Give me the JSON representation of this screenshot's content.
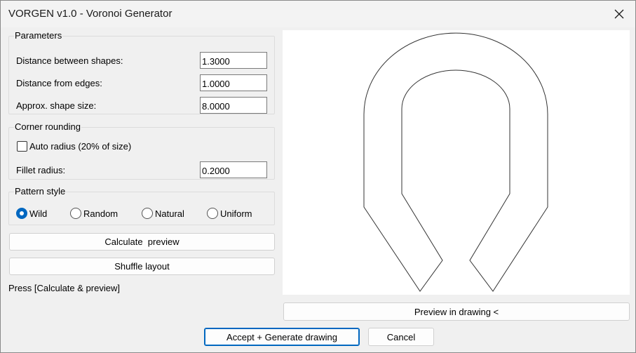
{
  "window": {
    "title": "VORGEN v1.0 - Voronoi Generator"
  },
  "parameters": {
    "label": "Parameters",
    "distance_between_shapes": {
      "label": "Distance between shapes:",
      "value": "1.3000"
    },
    "distance_from_edges": {
      "label": "Distance from edges:",
      "value": "1.0000"
    },
    "approx_shape_size": {
      "label": "Approx. shape size:",
      "value": "8.0000"
    }
  },
  "corner_rounding": {
    "label": "Corner rounding",
    "auto_radius": {
      "label": "Auto radius (20% of size)",
      "checked": false
    },
    "fillet_radius": {
      "label": "Fillet radius:",
      "value": "0.2000"
    }
  },
  "pattern_style": {
    "label": "Pattern style",
    "options": [
      "Wild",
      "Random",
      "Natural",
      "Uniform"
    ],
    "selected": "Wild"
  },
  "buttons": {
    "calculate_preview": "Calculate  preview",
    "shuffle_layout": "Shuffle layout",
    "preview_in_drawing": "Preview in drawing <",
    "accept_generate": "Accept + Generate drawing",
    "cancel": "Cancel"
  },
  "status_text": "Press [Calculate & preview]"
}
